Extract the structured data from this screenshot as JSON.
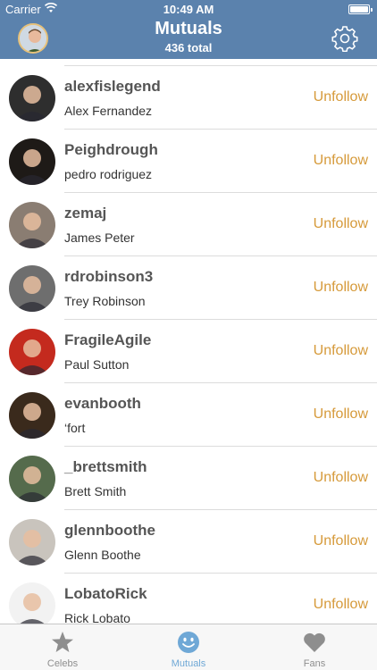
{
  "status_bar": {
    "carrier": "Carrier",
    "time": "10:49 AM",
    "battery_level": 1.0
  },
  "header": {
    "title": "Mutuals",
    "subtitle": "436 total",
    "avatar_icon": "profile-avatar",
    "settings_icon": "gear-icon"
  },
  "users": [
    {
      "handle": "alexfislegend",
      "name": "Alex Fernandez",
      "action": "Unfollow",
      "avatar_bg": "#2e2e2e"
    },
    {
      "handle": "Peighdrough",
      "name": "pedro rodriguez",
      "action": "Unfollow",
      "avatar_bg": "#1e1a17"
    },
    {
      "handle": "zemaj",
      "name": "James Peter",
      "action": "Unfollow",
      "avatar_bg": "#8a7d72"
    },
    {
      "handle": "rdrobinson3",
      "name": "Trey Robinson",
      "action": "Unfollow",
      "avatar_bg": "#6e6e6e"
    },
    {
      "handle": "FragileAgile",
      "name": "Paul Sutton",
      "action": "Unfollow",
      "avatar_bg": "#c42a1e"
    },
    {
      "handle": "evanbooth",
      "name": "‘fort",
      "action": "Unfollow",
      "avatar_bg": "#3a2a1c"
    },
    {
      "handle": "_brettsmith",
      "name": "Brett Smith",
      "action": "Unfollow",
      "avatar_bg": "#556b4c"
    },
    {
      "handle": "glennboothe",
      "name": "Glenn Boothe",
      "action": "Unfollow",
      "avatar_bg": "#c9c4bd"
    },
    {
      "handle": "LobatoRick",
      "name": "Rick Lobato",
      "action": "Unfollow",
      "avatar_bg": "#f2f2f2"
    }
  ],
  "tabs": [
    {
      "label": "Celebs",
      "icon": "star-icon",
      "active": false
    },
    {
      "label": "Mutuals",
      "icon": "smiley-icon",
      "active": true
    },
    {
      "label": "Fans",
      "icon": "heart-icon",
      "active": false
    }
  ],
  "colors": {
    "nav_bar": "#5b82ad",
    "unfollow": "#d69a3a",
    "active_tab": "#6fa8d6",
    "inactive_tab": "#8e8e8e"
  }
}
